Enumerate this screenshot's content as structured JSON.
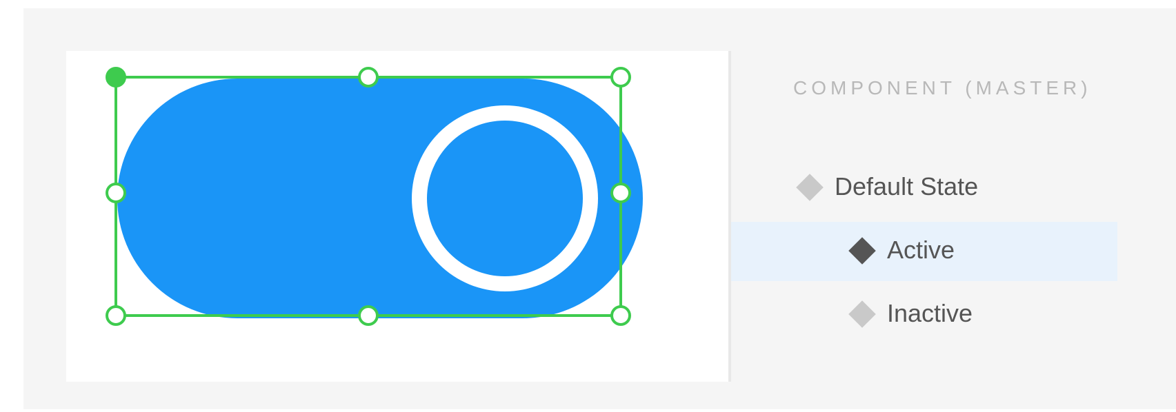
{
  "section_heading": "COMPONENT (MASTER)",
  "states": [
    {
      "label": "Default State",
      "selected": false,
      "icon": "diamond-icon",
      "icon_color": "#c9c9c9"
    },
    {
      "label": "Active",
      "selected": true,
      "icon": "diamond-icon",
      "icon_color": "#555555"
    },
    {
      "label": "Inactive",
      "selected": false,
      "icon": "diamond-icon",
      "icon_color": "#c9c9c9"
    }
  ],
  "toggle": {
    "state": "on",
    "track_color": "#1a95f7",
    "knob_ring_color": "#ffffff",
    "selection_color": "#3ecb4e"
  }
}
